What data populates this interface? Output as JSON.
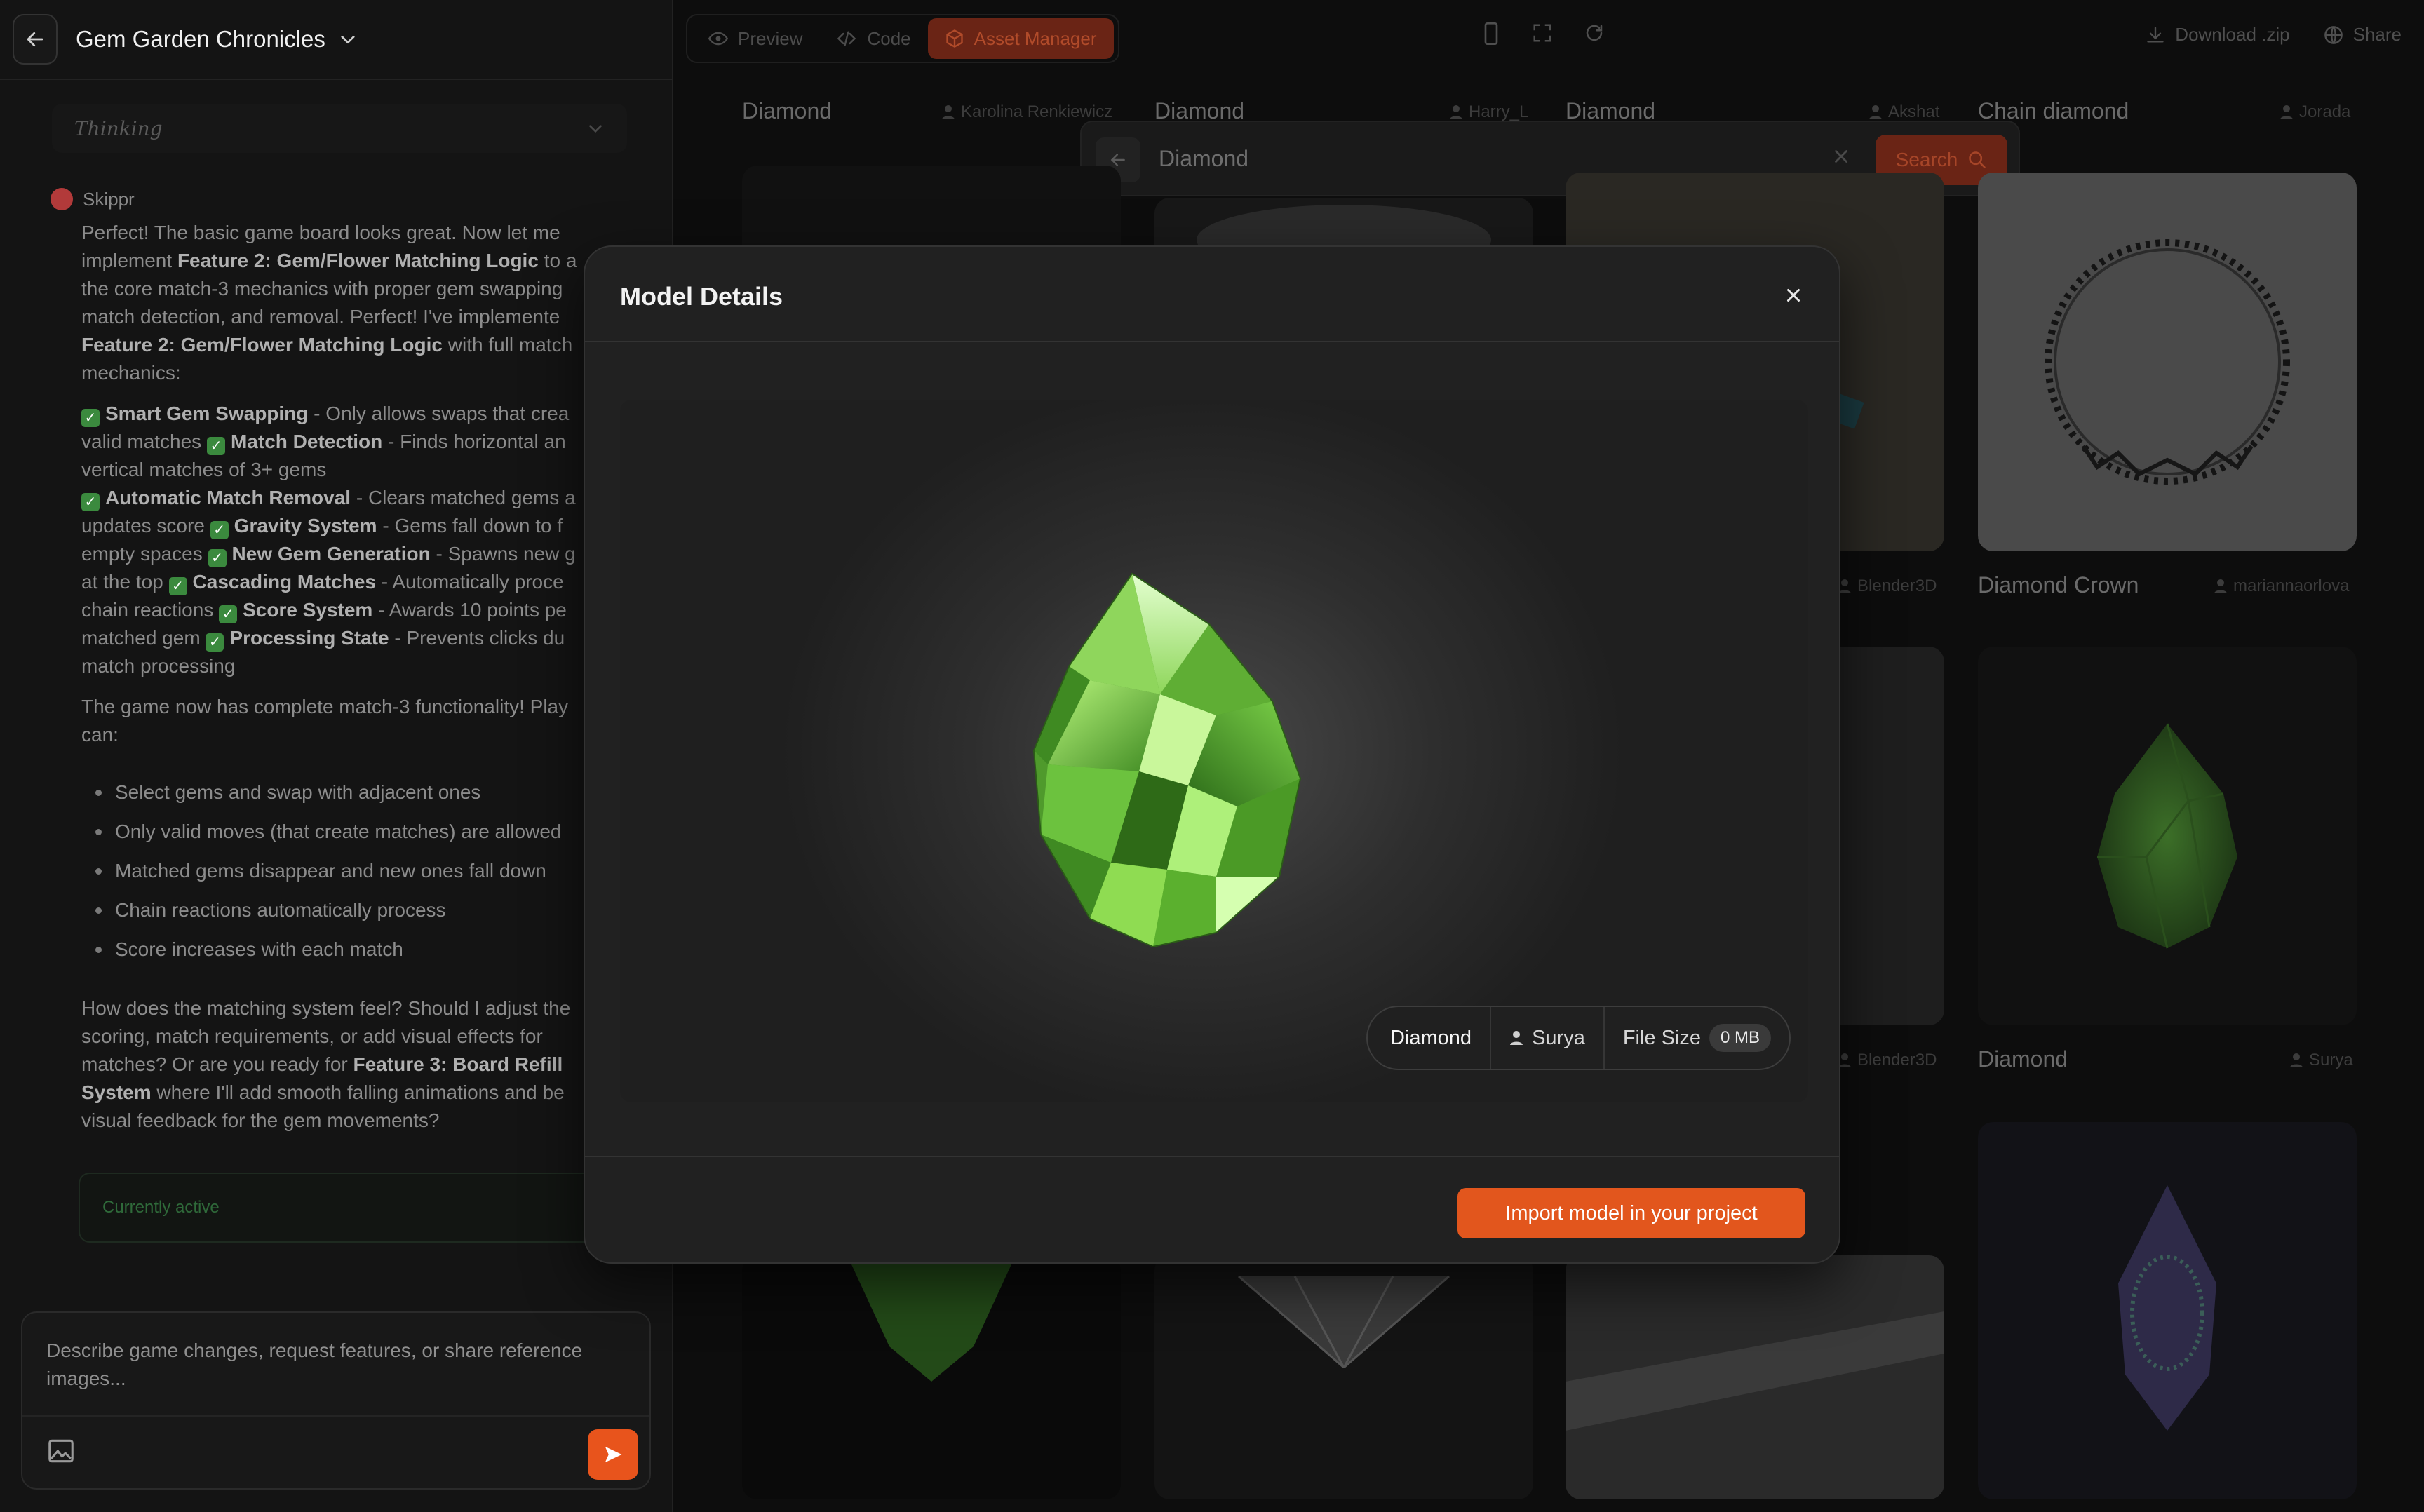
{
  "header": {
    "project_title": "Gem Garden Chronicles"
  },
  "chat": {
    "thinking_label": "Thinking",
    "sender": "Skippr",
    "intro_a": "Perfect! The basic game board looks great. Now let me",
    "intro_b": "implement ",
    "intro_b_bold": "Feature 2: Gem/Flower Matching Logic",
    "intro_b_end": " to a",
    "intro_c": "the core match-3 mechanics with proper gem swapping",
    "intro_d": "match detection, and removal. Perfect! I've implemente",
    "intro_e_bold": "Feature 2: Gem/Flower Matching Logic",
    "intro_e_end": " with full match",
    "intro_f": "mechanics:",
    "feat1_bold": "Smart Gem Swapping",
    "feat1_text": " - Only allows swaps that crea",
    "feat1b": "valid matches ",
    "feat2_bold": "Match Detection",
    "feat2_text": " - Finds horizontal an",
    "feat2b": "vertical matches of 3+ gems",
    "feat3_bold": "Automatic Match Removal",
    "feat3_text": " - Clears matched gems a",
    "feat3b": "updates score ",
    "feat4_bold": "Gravity System",
    "feat4_text": " - Gems fall down to f",
    "feat4b": "empty spaces ",
    "feat5_bold": "New Gem Generation",
    "feat5_text": " - Spawns new g",
    "feat5b": "at the top ",
    "feat6_bold": "Cascading Matches",
    "feat6_text": " - Automatically proce",
    "feat6b": "chain reactions ",
    "feat7_bold": "Score System",
    "feat7_text": " - Awards 10 points pe",
    "feat7b": "matched gem ",
    "feat8_bold": "Processing State",
    "feat8_text": " - Prevents clicks du",
    "feat8b": "match processing",
    "summary_a": "The game now has complete match-3 functionality! Play",
    "summary_b": "can:",
    "bullets": [
      "Select gems and swap with adjacent ones",
      "Only valid moves (that create matches) are allowed",
      "Matched gems disappear and new ones fall down",
      "Chain reactions automatically process",
      "Score increases with each match"
    ],
    "question_a": "How does the matching system feel? Should I adjust the",
    "question_b": "scoring, match requirements, or add visual effects for",
    "question_c": "matches? Or are you ready for ",
    "question_c_bold": "Feature 3: Board Refill",
    "question_d_bold": "System",
    "question_d": " where I'll add smooth falling animations and be",
    "question_e": "visual feedback for the gem movements?",
    "active_label": "Currently active",
    "composer_placeholder": "Describe game changes, request features, or share reference images..."
  },
  "toolbar": {
    "tabs": [
      {
        "label": "Preview",
        "icon": "eye-icon",
        "active": false
      },
      {
        "label": "Code",
        "icon": "code-icon",
        "active": false
      },
      {
        "label": "Asset Manager",
        "icon": "cube-icon",
        "active": true
      }
    ],
    "download_label": "Download .zip",
    "share_label": "Share"
  },
  "search": {
    "value": "Diamond",
    "button_label": "Search"
  },
  "grid": {
    "row1": [
      {
        "name": "Diamond",
        "author": "Karolina Renkiewicz"
      },
      {
        "name": "Diamond",
        "author": "Harry_L"
      },
      {
        "name": "Diamond",
        "author": "Akshat"
      },
      {
        "name": "Chain diamond",
        "author": "Jorada"
      }
    ],
    "row2": [
      {
        "name": "",
        "author": "Blender3D"
      },
      {
        "name": "Diamond Crown",
        "author": "mariannaorlova"
      }
    ],
    "row3": [
      {
        "name": "",
        "author": "Blender3D"
      },
      {
        "name": "Diamond",
        "author": "Surya"
      }
    ]
  },
  "modal": {
    "title": "Model Details",
    "model_name": "Diamond",
    "author": "Surya",
    "file_size_label": "File Size",
    "file_size_value": "0 MB",
    "import_label": "Import model in your project"
  },
  "colors": {
    "accent": "#e2561d",
    "background": "#0d0d0d",
    "modal": "#212121",
    "gem": "#6fc23a"
  }
}
